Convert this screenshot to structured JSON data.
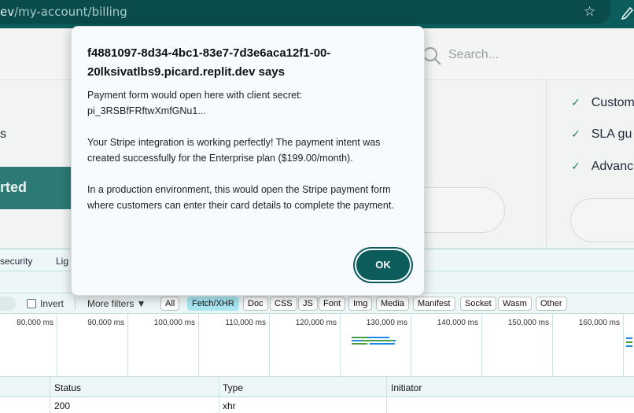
{
  "browser": {
    "url_visible_start": "ev",
    "url_path": "/my-account/billing",
    "star_icon": "bookmark-star-icon",
    "extension_icon": "pen-icon"
  },
  "page": {
    "search_placeholder": "Search...",
    "left_text": "s",
    "cta_label": "rted",
    "features": [
      "Custom",
      "SLA gu",
      "Advanc"
    ],
    "accent_color": "#2b7a73"
  },
  "devtools": {
    "tabs": [
      "security",
      "Lig"
    ],
    "invert_label": "Invert",
    "more_filters_label": "More filters ▼",
    "filter_chips": [
      {
        "label": "All",
        "active": false
      },
      {
        "label": "Fetch/XHR",
        "active": true
      },
      {
        "label": "Doc",
        "active": false
      },
      {
        "label": "CSS",
        "active": false
      },
      {
        "label": "JS",
        "active": false
      },
      {
        "label": "Font",
        "active": false
      },
      {
        "label": "Img",
        "active": false
      },
      {
        "label": "Media",
        "active": false
      },
      {
        "label": "Manifest",
        "active": false
      },
      {
        "label": "Socket",
        "active": false
      },
      {
        "label": "Wasm",
        "active": false
      },
      {
        "label": "Other",
        "active": false
      }
    ],
    "timeline_ticks": [
      "80,000 ms",
      "90,000 ms",
      "100,000 ms",
      "110,000 ms",
      "120,000 ms",
      "130,000 ms",
      "140,000 ms",
      "150,000 ms",
      "160,000 ms"
    ],
    "columns": [
      "Status",
      "Type",
      "Initiator"
    ],
    "rows": [
      {
        "status": "200",
        "type": "xhr",
        "initiator": ""
      }
    ]
  },
  "dialog": {
    "title": "f4881097-8d34-4bc1-83e7-7d3e6aca12f1-00-20lksivatlbs9.picard.replit.dev says",
    "line1": "Payment form would open here with client secret: pi_3RSBfFRftwXmfGNu1...",
    "line2": "Your Stripe integration is working perfectly! The payment intent was created successfully for the Enterprise plan ($199.00/month).",
    "line3": "In a production environment, this would open the Stripe payment form where customers can enter their card details to complete the payment.",
    "ok_label": "OK",
    "ok_color": "#0d5c5c"
  }
}
